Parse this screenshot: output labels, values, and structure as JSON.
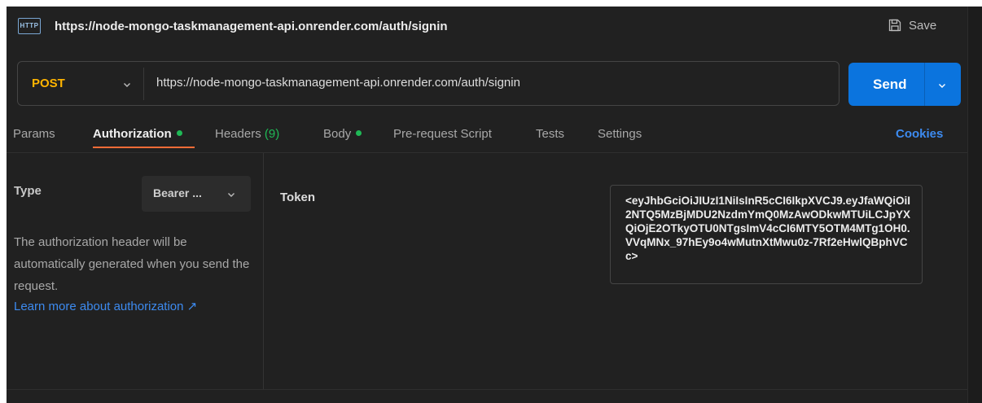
{
  "titlebar": {
    "badge": "HTTP",
    "url": "https://node-mongo-taskmanagement-api.onrender.com/auth/signin",
    "save_label": "Save"
  },
  "request": {
    "method": "POST",
    "url": "https://node-mongo-taskmanagement-api.onrender.com/auth/signin",
    "send_label": "Send"
  },
  "tabs": {
    "params": "Params",
    "authorization": "Authorization",
    "headers": "Headers",
    "headers_count": "(9)",
    "body": "Body",
    "prerequest": "Pre-request Script",
    "tests": "Tests",
    "settings": "Settings",
    "cookies": "Cookies"
  },
  "auth": {
    "type_label": "Type",
    "type_value": "Bearer ...",
    "description": "The authorization header will be automatically generated when you send the request.",
    "link": "Learn more about authorization ↗",
    "token_label": "Token",
    "token_value": "<eyJhbGciOiJIUzI1NiIsInR5cCI6IkpXVCJ9.eyJfaWQiOiI2NTQ5MzBjMDU2NzdmYmQ0MzAwODkwMTUiLCJpYXQiOjE2OTkyOTU0NTgsImV4cCI6MTY5OTM4MTg1OH0.VVqMNx_97hEy9o4wMutnXtMwu0z-7Rf2eHwlQBphVCc>"
  },
  "colors": {
    "background": "#212121",
    "method": "#ffb400",
    "send": "#0b74de",
    "active_tab_underline": "#ff6c37",
    "status_dot": "#1fb956",
    "link": "#3d8bf0"
  }
}
